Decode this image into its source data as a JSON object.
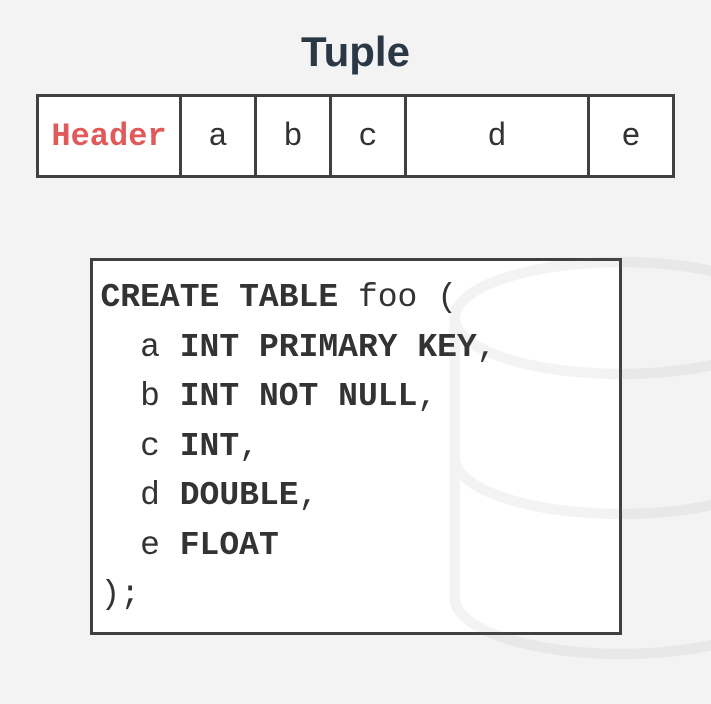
{
  "title": "Tuple",
  "tuple": {
    "header_label": "Header",
    "columns": {
      "a": "a",
      "b": "b",
      "c": "c",
      "d": "d",
      "e": "e"
    }
  },
  "sql": {
    "create": "CREATE TABLE",
    "table_name": "foo",
    "open": "(",
    "cols": [
      {
        "name": "a",
        "type": "INT PRIMARY KEY",
        "comma": ","
      },
      {
        "name": "b",
        "type": "INT NOT NULL",
        "comma": ","
      },
      {
        "name": "c",
        "type": "INT",
        "comma": ","
      },
      {
        "name": "d",
        "type": "DOUBLE",
        "comma": ","
      },
      {
        "name": "e",
        "type": "FLOAT",
        "comma": ""
      }
    ],
    "close": ");"
  }
}
